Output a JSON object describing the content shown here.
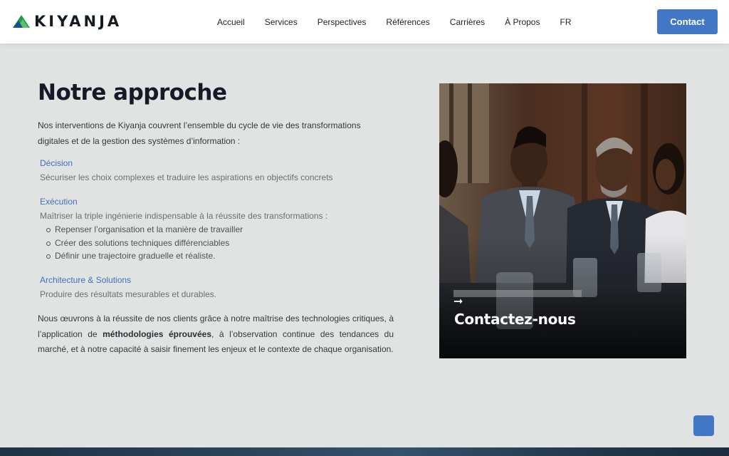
{
  "header": {
    "logo_text": "KIYANJA",
    "nav": [
      "Accueil",
      "Services",
      "Perspectives",
      "Références",
      "Carrières",
      "À Propos",
      "FR"
    ],
    "contact_label": "Contact"
  },
  "main": {
    "title": "Notre approche",
    "intro": "Nos interventions de Kiyanja couvrent l’ensemble du cycle de vie des transformations digitales et de la gestion des systèmes d’information :",
    "sections": [
      {
        "heading": "Décision",
        "text": "Sécuriser les choix complexes et traduire les aspirations en objectifs concrets"
      },
      {
        "heading": "Exécution",
        "text": "Maîtriser la triple ingénierie indispensable à la réussite des transformations :",
        "bullets": [
          "Repenser l’organisation et la manière de travailler",
          "Créer des solutions techniques différenciables",
          "Définir une trajectoire graduelle et réaliste."
        ]
      },
      {
        "heading": "Architecture & Solutions",
        "text": "Produire des résultats mesurables et durables."
      }
    ],
    "closing_before": "Nous œuvrons à la réussite de nos clients grâce à notre maîtrise des technologies critiques, à  l’application de ",
    "closing_bold": "méthodologies éprouvées",
    "closing_after": ", à l’observation continue des tendances du marché,  et à notre capacité à saisir finement les enjeux et le contexte de chaque organisation."
  },
  "photo_card": {
    "arrow_icon": "arrow-right-icon",
    "cta_label": "Contactez-nous"
  },
  "colors": {
    "accent": "#4277c6",
    "background": "#e1e3e3",
    "title": "#141b27"
  }
}
